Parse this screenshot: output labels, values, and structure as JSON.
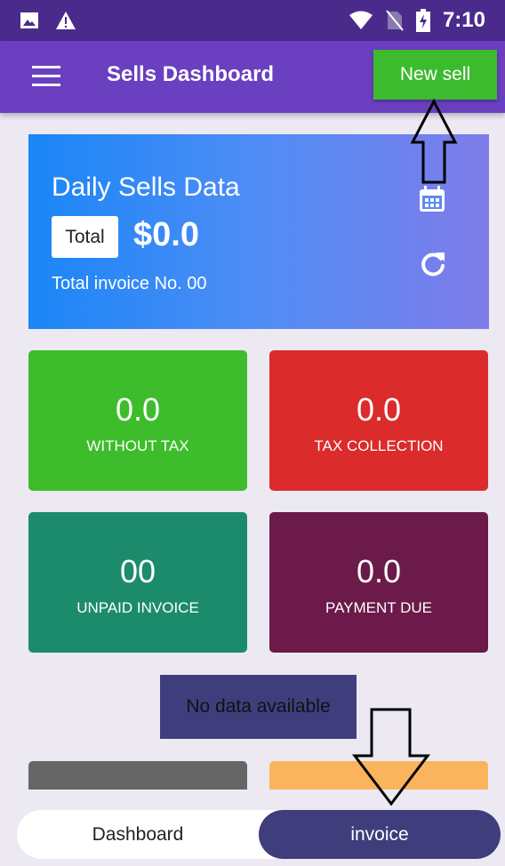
{
  "status_bar": {
    "time": "7:10",
    "icons": [
      "image-icon",
      "warning-icon",
      "wifi-icon",
      "no-sim-icon",
      "battery-charging-icon"
    ]
  },
  "app_bar": {
    "title": "Sells Dashboard",
    "new_sell_label": "New sell",
    "menu_icon": "hamburger-menu-icon"
  },
  "daily_card": {
    "title": "Daily Sells Data",
    "total_label": "Total",
    "total_amount": "$0.0",
    "invoice_text": "Total invoice No. 00",
    "calendar_icon": "calendar-icon",
    "refresh_icon": "refresh-icon"
  },
  "tiles": [
    {
      "value": "0.0",
      "label": "WITHOUT TAX"
    },
    {
      "value": "0.0",
      "label": "TAX COLLECTION"
    },
    {
      "value": "00",
      "label": "UNPAID INVOICE"
    },
    {
      "value": "0.0",
      "label": "PAYMENT DUE"
    }
  ],
  "no_data": "No data available",
  "bottom_nav": {
    "dashboard": "Dashboard",
    "invoice": "invoice"
  },
  "colors": {
    "status_bar": "#4a2b8c",
    "app_bar": "#6a3fc0",
    "new_sell": "#3dbb2e",
    "tile_without_tax": "#3dbd2c",
    "tile_tax_collection": "#db2b2b",
    "tile_unpaid_invoice": "#1c8b6c",
    "tile_payment_due": "#6b1a49",
    "nav_active": "#3f3d7c"
  }
}
